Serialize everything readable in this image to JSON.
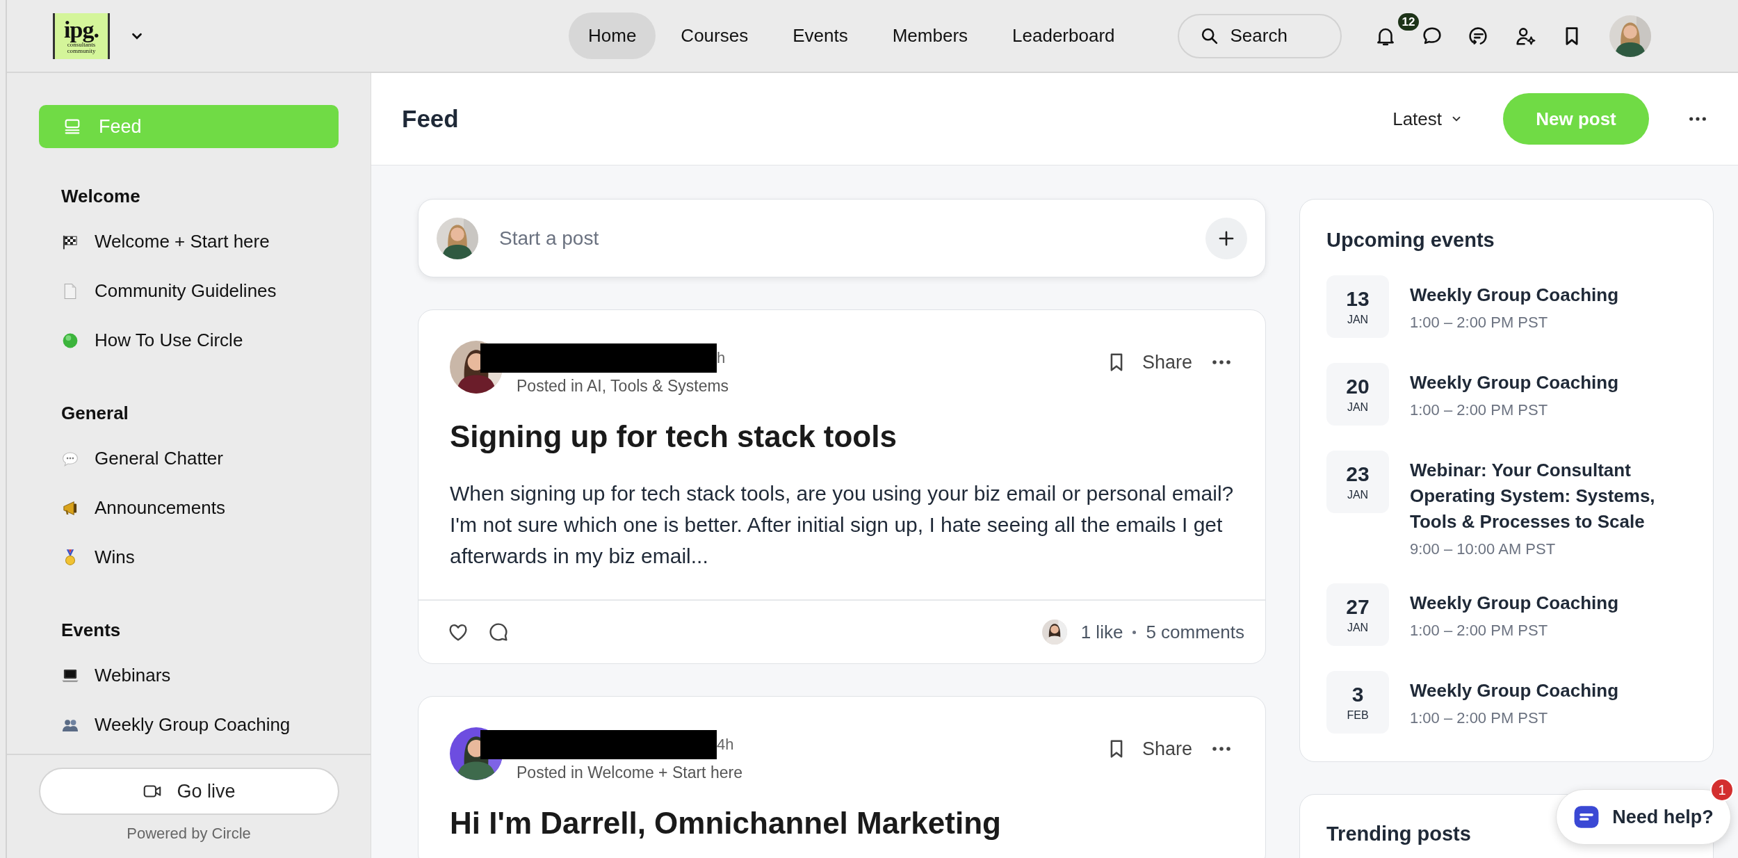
{
  "top_bar": {
    "logo": {
      "mark": "ipg.",
      "line_1": "consultants",
      "line_2": "community"
    },
    "nav": [
      {
        "label": "Home",
        "selected": true
      },
      {
        "label": "Courses",
        "selected": false
      },
      {
        "label": "Events",
        "selected": false
      },
      {
        "label": "Members",
        "selected": false
      },
      {
        "label": "Leaderboard",
        "selected": false
      }
    ],
    "search": {
      "placeholder": "Search"
    },
    "notifications_badge": "12"
  },
  "sidebar": {
    "feed": {
      "label": "Feed",
      "selected": true
    },
    "sections": [
      {
        "title": "Welcome",
        "items": [
          {
            "label": "Welcome + Start here",
            "kind": "flag"
          },
          {
            "label": "Community Guidelines",
            "kind": "page"
          },
          {
            "label": "How To Use Circle",
            "kind": "dot"
          }
        ]
      },
      {
        "title": "General",
        "items": [
          {
            "label": "General Chatter",
            "kind": "speech"
          },
          {
            "label": "Announcements",
            "kind": "megaphone"
          },
          {
            "label": "Wins",
            "kind": "medal"
          }
        ]
      },
      {
        "title": "Events",
        "items": [
          {
            "label": "Webinars",
            "kind": "laptop"
          },
          {
            "label": "Weekly Group Coaching",
            "kind": "people"
          }
        ]
      }
    ],
    "go_live": "Go live",
    "footer": "Powered by Circle"
  },
  "header": {
    "title": "Feed",
    "sort": "Latest",
    "new_post": "New post"
  },
  "composer": {
    "placeholder": "Start a post"
  },
  "posts": [
    {
      "time": "h",
      "category": "Posted in AI, Tools & Systems",
      "share": "Share",
      "title": "Signing up for tech stack tools",
      "body": "When signing up for tech stack tools, are you using your biz email or personal email? I'm not sure which one is better. After initial sign up, I hate seeing all the emails I get afterwards in my biz email...",
      "likes": "1 like",
      "comments": "5 comments"
    },
    {
      "time": "4h",
      "category": "Posted in Welcome + Start here",
      "share": "Share",
      "title": "Hi I'm Darrell, Omnichannel Marketing"
    }
  ],
  "upcoming_events": {
    "title": "Upcoming events",
    "events": [
      {
        "day": "13",
        "month": "JAN",
        "title": "Weekly Group Coaching",
        "time": "1:00 – 2:00 PM PST"
      },
      {
        "day": "20",
        "month": "JAN",
        "title": "Weekly Group Coaching",
        "time": "1:00 – 2:00 PM PST"
      },
      {
        "day": "23",
        "month": "JAN",
        "title": "Webinar: Your Consultant Operating System: Systems, Tools & Processes to Scale",
        "time": "9:00 – 10:00 AM PST"
      },
      {
        "day": "27",
        "month": "JAN",
        "title": "Weekly Group Coaching",
        "time": "1:00 – 2:00 PM PST"
      },
      {
        "day": "3",
        "month": "FEB",
        "title": "Weekly Group Coaching",
        "time": "1:00 – 2:00 PM PST"
      }
    ]
  },
  "trending_posts": {
    "title": "Trending posts"
  },
  "help_widget": {
    "label": "Need help?",
    "badge": "1"
  }
}
